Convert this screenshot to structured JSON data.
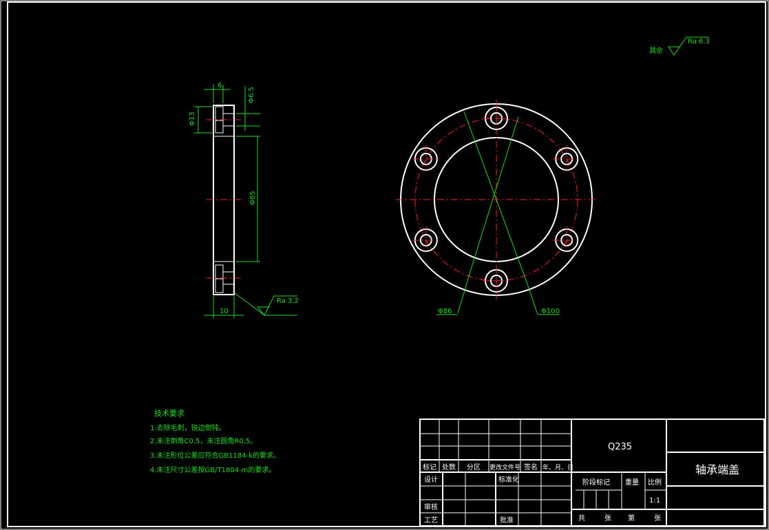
{
  "surface": {
    "other_label": "其余",
    "other_roughness": "Ra 6.3",
    "side_roughness": "Ra 3.2"
  },
  "side_view": {
    "dim_width": "6",
    "dim_hole_small": "Φ6.5",
    "dim_hole_big": "Φ13",
    "dim_bore": "Φ65",
    "dim_bottom": "10"
  },
  "front_view": {
    "dim_pcd": "Φ86",
    "dim_outer": "Φ100"
  },
  "tech": {
    "title": "技术要求",
    "items": [
      "1.去除毛刺，锐边倒钝。",
      "2.未注倒角C0.5，未注圆角R0.5。",
      "3.未注形位公差应符合GB1184-k的要求。",
      "4.未注尺寸公差按GB/T1804-m的要求。"
    ]
  },
  "title_block": {
    "material": "Q235",
    "part_name": "轴承端盖",
    "hdr_mark": "标记",
    "hdr_count": "处数",
    "hdr_zone": "分区",
    "hdr_docno": "更改文件号",
    "hdr_sign": "签名",
    "hdr_date": "年、月、日",
    "design": "设计",
    "standard": "标准化",
    "review": "审核",
    "process": "工艺",
    "approve": "批准",
    "stage": "阶段标记",
    "weight": "重量",
    "scale": "比例",
    "scale_value": "1:1",
    "total": "共",
    "sheets": "张",
    "page": "第",
    "sheet2": "张"
  }
}
